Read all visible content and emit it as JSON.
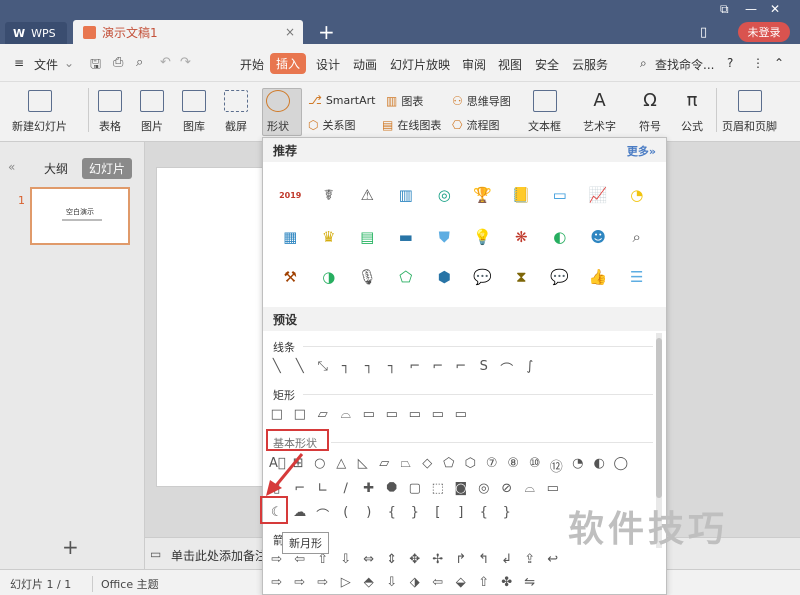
{
  "brand": {
    "wps_label": "WPS"
  },
  "tabs": {
    "doc_title": "演示文稿1",
    "close_glyph": "×",
    "new_tab_glyph": "+"
  },
  "window": {
    "login_label": "未登录"
  },
  "menu": {
    "file_label": "文件",
    "tabs": [
      "开始",
      "插入",
      "设计",
      "动画",
      "幻灯片放映",
      "审阅",
      "视图",
      "安全",
      "云服务"
    ],
    "search_label": "查找命令...",
    "help": "?"
  },
  "ribbon": {
    "new_slide": "新建幻灯片",
    "table": "表格",
    "picture": "图片",
    "gallery": "图库",
    "screenshot": "截屏",
    "shape": "形状",
    "smartart": "SmartArt",
    "chart": "图表",
    "mindmap": "思维导图",
    "relation": "关系图",
    "online_chart": "在线图表",
    "flowchart": "流程图",
    "textbox": "文本框",
    "wordart": "艺术字",
    "symbol": "符号",
    "formula": "公式",
    "header_footer": "页眉和页脚"
  },
  "panel": {
    "outline_tab": "大纲",
    "slides_tab": "幻灯片",
    "slide_number": "1",
    "thumb_title": "空白演示",
    "add_glyph": "+"
  },
  "notes": {
    "placeholder": "单击此处添加备注"
  },
  "status": {
    "slide_count": "幻灯片 1 / 1",
    "theme": "Office 主题"
  },
  "dropdown": {
    "recommend_header": "推荐",
    "more_link": "更多»",
    "recommend_row1": [
      "2019",
      "☤",
      "⚠",
      "▥",
      "◎",
      "🏆",
      "📒",
      "▭",
      "📈",
      "◔"
    ],
    "recommend_row2": [
      "▦",
      "♛",
      "▤",
      "▬",
      "⛊",
      "💡",
      "❋",
      "◐",
      "☻",
      "⌕"
    ],
    "recommend_row3": [
      "⚒",
      "◑",
      "🎙",
      "⬠",
      "⬢",
      "💬",
      "⧗",
      "💬",
      "👍",
      "☰"
    ],
    "preset_header": "预设",
    "lines_label": "线条",
    "lines_row": [
      "╲",
      "╲",
      "⤡",
      "┐",
      "┐",
      "┐",
      "⌐",
      "⌐",
      "⌐",
      "S",
      "⌒",
      "∫"
    ],
    "rect_label": "矩形",
    "rect_row": [
      "□",
      "□",
      "▱",
      "⌓",
      "▭",
      "▭",
      "▭",
      "▭",
      "▭"
    ],
    "basic_label": "基本形状",
    "basic_row1": [
      "A⃞",
      "⊞",
      "○",
      "△",
      "◺",
      "▱",
      "⏢",
      "◇",
      "⬠",
      "⬡",
      "⑦",
      "⑧",
      "⑩",
      "⑫",
      "◔",
      "◐",
      "◯"
    ],
    "basic_row2": [
      "▯",
      "⌐",
      "∟",
      "∕",
      "✚",
      "⯃",
      "▢",
      "⬚",
      "◙",
      "◎",
      "⊘",
      "⌓",
      "▭"
    ],
    "basic_row3": [
      "☾",
      "☁",
      "⌒",
      "(",
      ")",
      "{",
      "}",
      "[",
      "]",
      "{",
      "}"
    ],
    "tooltip": "新月形",
    "arrows_label": "箭",
    "arrows_row1": [
      "⇨",
      "⇦",
      "⇧",
      "⇩",
      "⇔",
      "⇕",
      "✥",
      "✢",
      "↱",
      "↰",
      "↲",
      "⇪",
      "↩"
    ],
    "arrows_row2": [
      "⇨",
      "⇨",
      "⇨",
      "▷",
      "⬘",
      "⇩",
      "⬗",
      "⇦",
      "⬙",
      "⇧",
      "✤",
      "⇋"
    ]
  },
  "watermark": "软件技巧"
}
